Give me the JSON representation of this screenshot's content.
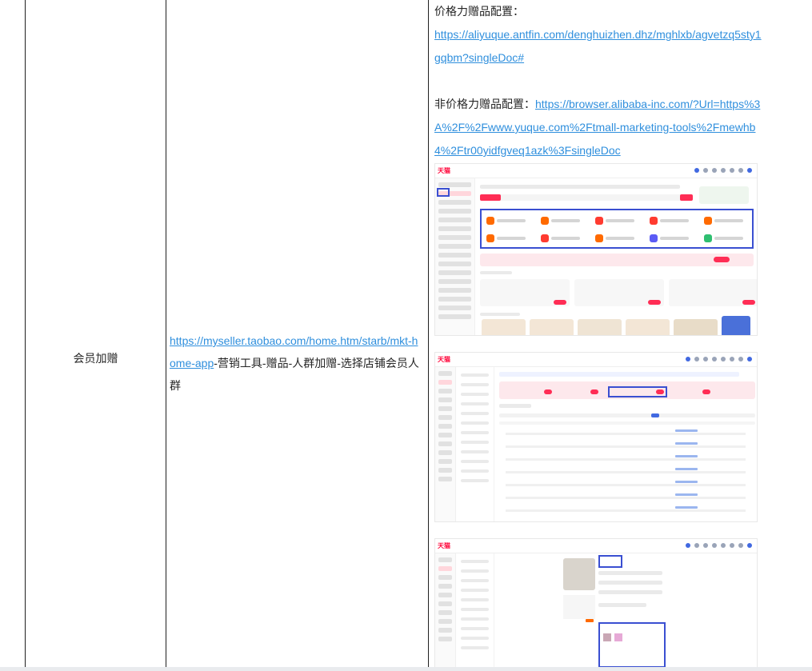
{
  "row": {
    "label": "会员加赠",
    "path": {
      "link_text": "https://myseller.taobao.com/home.htm/starb/mkt-home-app",
      "suffix": "-营销工具-赠品-人群加赠-选择店铺会员人群"
    },
    "notes": {
      "price_gift_label": "价格力赠品配置：",
      "price_gift_url": "https://aliyuque.antfin.com/denghuizhen.dhz/mghlxb/agvetzq5sty1gqbm?singleDoc#",
      "non_price_gift_label": "非价格力赠品配置：",
      "non_price_gift_url": "https://browser.alibaba-inc.com/?Url=https%3A%2F%2Fwww.yuque.com%2Ftmall-marketing-tools%2Fmewhb4%2Ftr00yidfgveq1azk%3FsingleDoc"
    },
    "screenshots": {
      "shot1": {
        "brand": "天猫"
      },
      "shot2": {
        "brand": "天猫"
      },
      "shot3": {
        "brand": "天猫"
      }
    }
  },
  "colors": {
    "link": "#2f8fdd",
    "highlight_box": "#3a4fd1",
    "brand_red": "#ff0036"
  }
}
